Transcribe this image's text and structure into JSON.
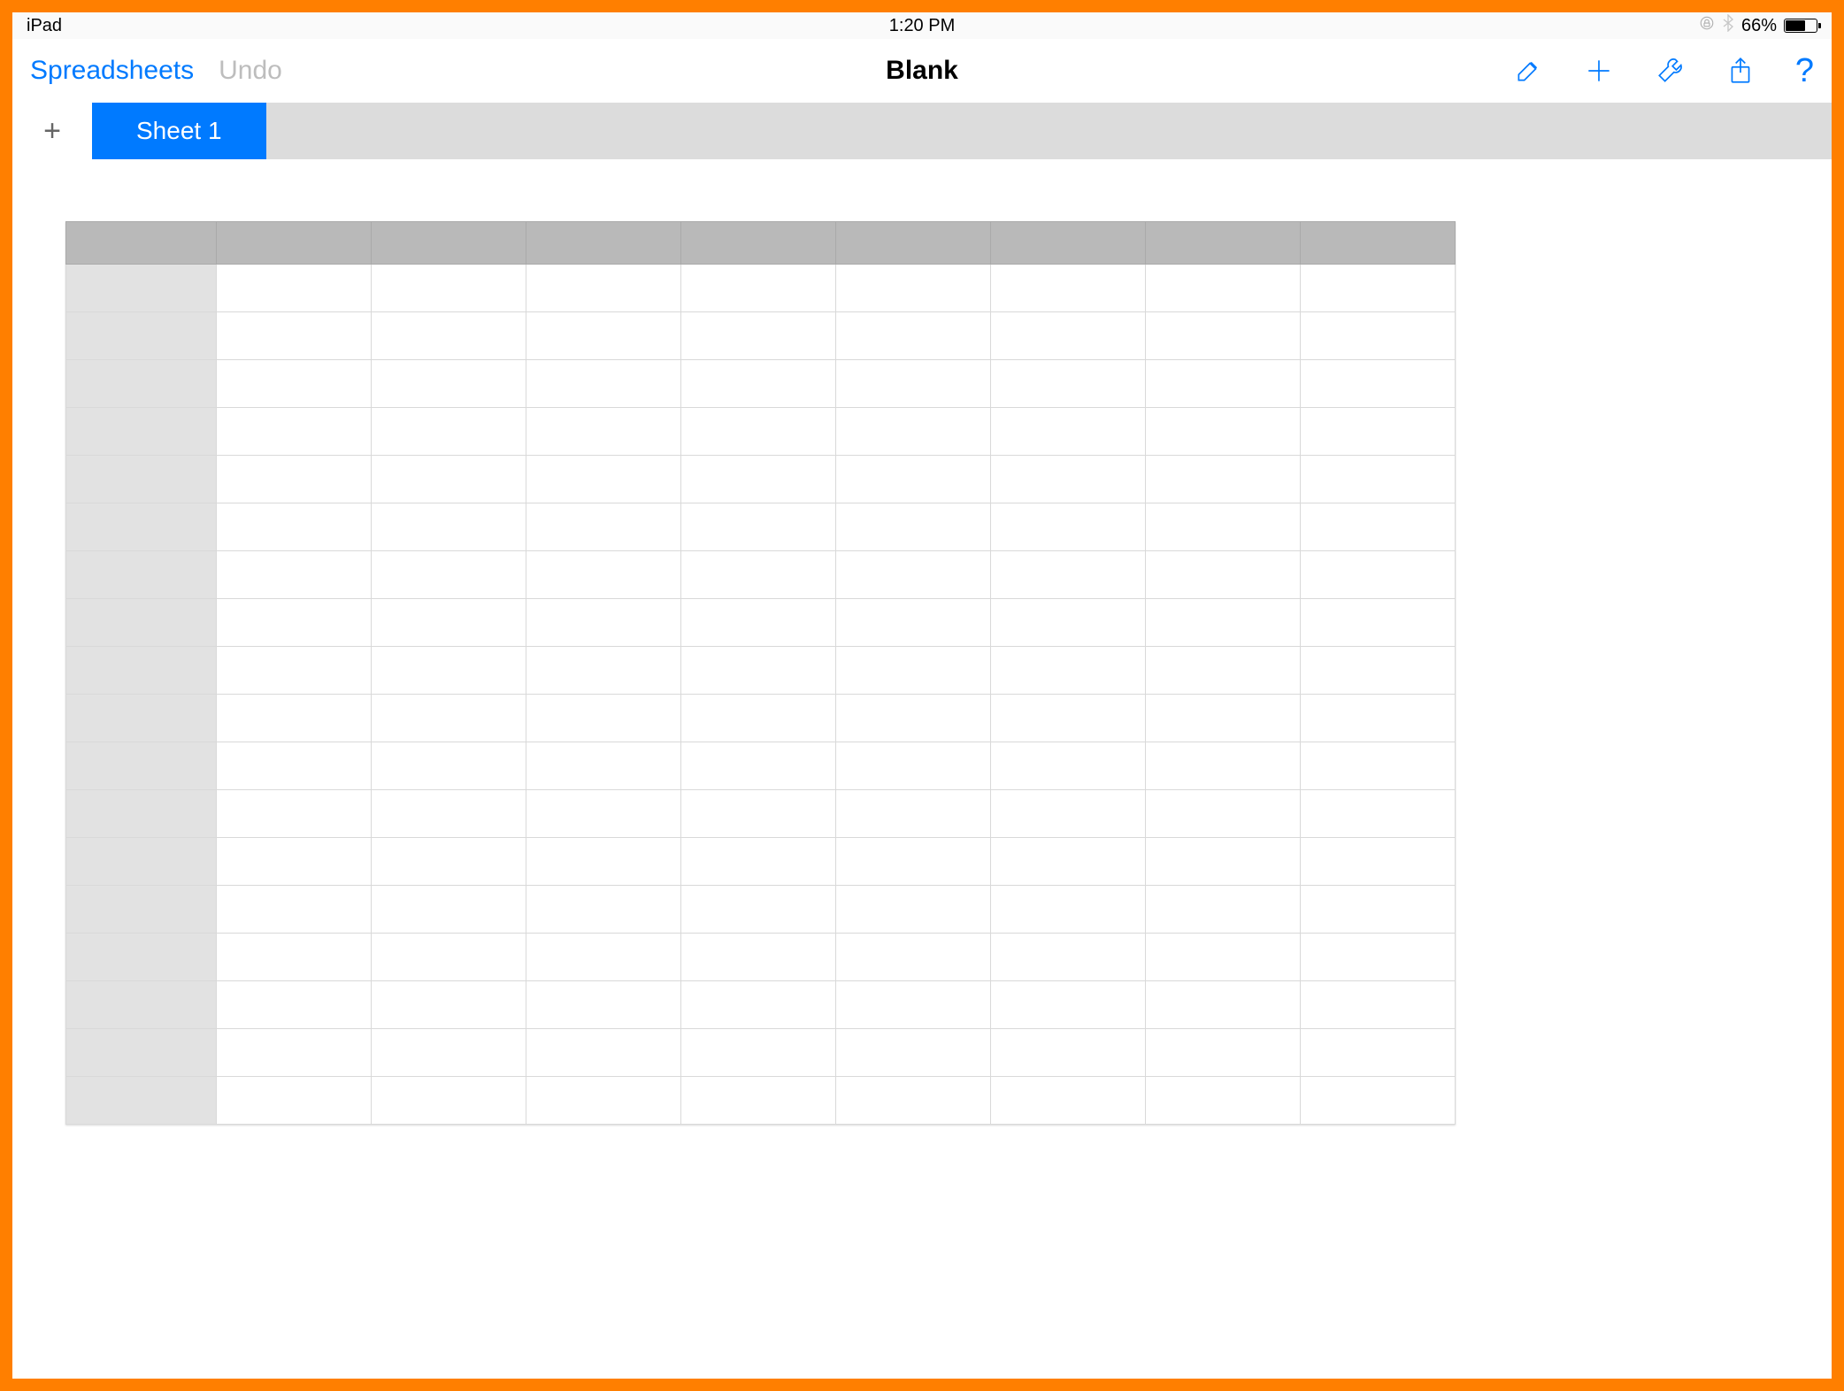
{
  "status": {
    "device": "iPad",
    "time": "1:20 PM",
    "battery_pct": "66%"
  },
  "toolbar": {
    "back_label": "Spreadsheets",
    "undo_label": "Undo",
    "title": "Blank"
  },
  "tabs": {
    "active_sheet": "Sheet 1"
  },
  "grid": {
    "columns": 8,
    "rows": 18
  },
  "colors": {
    "accent": "#007aff",
    "frame": "#ff7f00"
  }
}
